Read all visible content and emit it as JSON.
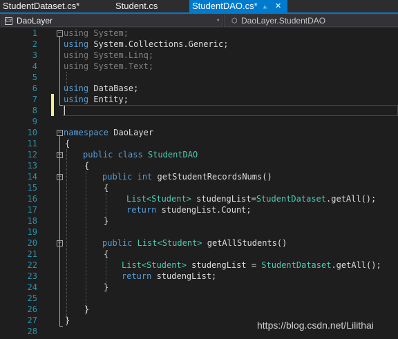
{
  "tabs": [
    {
      "label": "StudentDataset.cs*",
      "active": false
    },
    {
      "label": "Student.cs",
      "active": false
    },
    {
      "label": "StudentDAO.cs*",
      "active": true
    }
  ],
  "tab_icons": {
    "pin": "pin-icon",
    "close": "close-icon"
  },
  "nav": {
    "project": "DaoLayer",
    "member": "DaoLayer.StudentDAO",
    "project_icon": "csharp-project-icon",
    "member_icon": "namespace-class-icon"
  },
  "line_numbers": [
    "1",
    "2",
    "3",
    "4",
    "5",
    "6",
    "7",
    "8",
    "9",
    "10",
    "11",
    "12",
    "13",
    "14",
    "15",
    "16",
    "17",
    "18",
    "19",
    "20",
    "21",
    "22",
    "23",
    "24",
    "25",
    "26",
    "27",
    "28"
  ],
  "code": {
    "l1": {
      "k": "using",
      "t": " System;"
    },
    "l2": {
      "k": "using",
      "t": " System.Collections.Generic;"
    },
    "l3": {
      "k": "using",
      "t": " System.Linq;"
    },
    "l4": {
      "k": "using",
      "t": " System.Text;"
    },
    "l6": {
      "k": "using",
      "t": " DataBase;"
    },
    "l7": {
      "k": "using",
      "t": " Entity;"
    },
    "l10": {
      "k": "namespace",
      "t": " DaoLayer"
    },
    "l11": {
      "t": "{"
    },
    "l12": {
      "k1": "public",
      "k2": "class",
      "ty": "StudentDAO"
    },
    "l13": {
      "t": "{"
    },
    "l14": {
      "k1": "public",
      "k2": "int",
      "t": " getStudentRecordsNums()"
    },
    "l15": {
      "t": "{"
    },
    "l16": {
      "ty1": "List<Student>",
      "t1": " studengList=",
      "ty2": "StudentDataset",
      "t2": ".getAll();"
    },
    "l17": {
      "k": "return",
      "t": " studengList.Count;"
    },
    "l18": {
      "t": "}"
    },
    "l20": {
      "k1": "public",
      "ty": "List<Student>",
      "t": " getAllStudents()"
    },
    "l21": {
      "t": "{"
    },
    "l22": {
      "ty1": "List<Student>",
      "t1": " studengList = ",
      "ty2": "StudentDataset",
      "t2": ".getAll();"
    },
    "l23": {
      "k": "return",
      "t": " studengList;"
    },
    "l24": {
      "t": "}"
    },
    "l26": {
      "t": "}"
    },
    "l27": {
      "t": "}"
    }
  },
  "watermark": "https://blog.csdn.net/Lilithai",
  "colors": {
    "background": "#1e1e1e",
    "keyword": "#569cd6",
    "type": "#4ec9b0",
    "line_number": "#2b91af",
    "accent": "#007acc",
    "change_marker": "#efef91"
  }
}
